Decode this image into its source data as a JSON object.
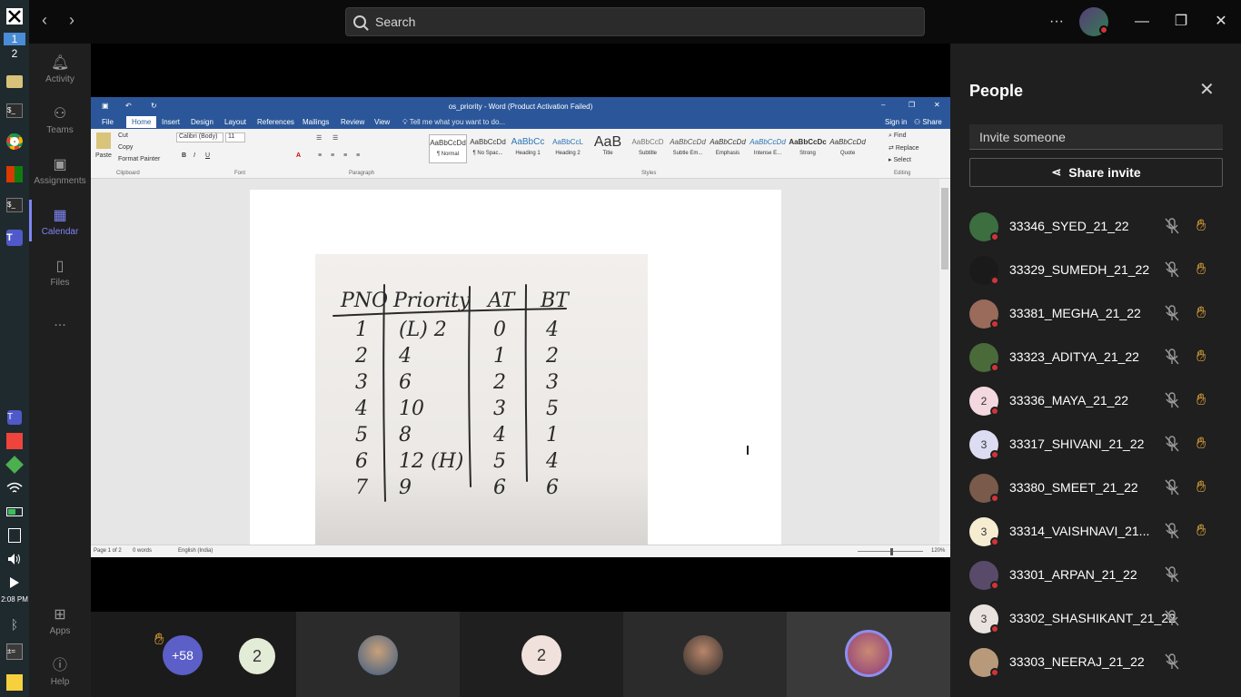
{
  "taskbar": {
    "desktop_numbers": [
      "1",
      "2"
    ],
    "clock": "2:08 PM"
  },
  "rail": {
    "items": [
      {
        "label": "Activity",
        "icon": "bell-icon"
      },
      {
        "label": "Teams",
        "icon": "teams-icon"
      },
      {
        "label": "Assignments",
        "icon": "assignments-icon"
      },
      {
        "label": "Calendar",
        "icon": "calendar-icon"
      },
      {
        "label": "Files",
        "icon": "files-icon"
      },
      {
        "label": "...",
        "icon": "more-icon"
      },
      {
        "label": "Apps",
        "icon": "apps-icon"
      },
      {
        "label": "Help",
        "icon": "help-icon"
      }
    ]
  },
  "titlebar": {
    "search_placeholder": "Search"
  },
  "word": {
    "title": "os_priority - Word (Product Activation Failed)",
    "tabs": [
      "File",
      "Home",
      "Insert",
      "Design",
      "Layout",
      "References",
      "Mailings",
      "Review",
      "View"
    ],
    "tell_me": "Tell me what you want to do...",
    "sign_in": "Sign in",
    "share": "Share",
    "clipboard": {
      "paste": "Paste",
      "cut": "Cut",
      "copy": "Copy",
      "format_painter": "Format Painter",
      "label": "Clipboard"
    },
    "font": {
      "name": "Calibri (Body)",
      "size": "11",
      "label": "Font"
    },
    "paragraph_label": "Paragraph",
    "styles_label": "Styles",
    "styles": [
      {
        "sample": "AaBbCcDd",
        "name": "¶ Normal"
      },
      {
        "sample": "AaBbCcDd",
        "name": "¶ No Spac..."
      },
      {
        "sample": "AaBbCc",
        "name": "Heading 1"
      },
      {
        "sample": "AaBbCcL",
        "name": "Heading 2"
      },
      {
        "sample": "AaB",
        "name": "Title"
      },
      {
        "sample": "AaBbCcD",
        "name": "Subtitle"
      },
      {
        "sample": "AaBbCcDd",
        "name": "Subtle Em..."
      },
      {
        "sample": "AaBbCcDd",
        "name": "Emphasis"
      },
      {
        "sample": "AaBbCcDd",
        "name": "Intense E..."
      },
      {
        "sample": "AaBbCcDc",
        "name": "Strong"
      },
      {
        "sample": "AaBbCcDd",
        "name": "Quote"
      }
    ],
    "editing": {
      "find": "Find",
      "replace": "Replace",
      "select": "Select",
      "label": "Editing"
    },
    "status": {
      "page": "Page 1 of 2",
      "words": "0 words",
      "language": "English (India)",
      "zoom": "120%"
    }
  },
  "handwritten_table": {
    "headers": [
      "PNO",
      "Priority",
      "AT",
      "BT"
    ],
    "rows": [
      [
        "1",
        "(L) 2",
        "0",
        "4"
      ],
      [
        "2",
        "4",
        "1",
        "2"
      ],
      [
        "3",
        "6",
        "2",
        "3"
      ],
      [
        "4",
        "10",
        "3",
        "5"
      ],
      [
        "5",
        "8",
        "4",
        "1"
      ],
      [
        "6",
        "12 (H)",
        "5",
        "4"
      ],
      [
        "7",
        "9",
        "6",
        "6"
      ]
    ]
  },
  "gallery": {
    "overflow_count": "+58",
    "tiles": [
      "2",
      "",
      "2",
      "",
      ""
    ]
  },
  "people": {
    "title": "People",
    "invite_placeholder": "Invite someone",
    "share_invite": "Share invite",
    "participants": [
      {
        "name": "33346_SYED_21_22",
        "avatar": "",
        "hand": true
      },
      {
        "name": "33329_SUMEDH_21_22",
        "avatar": "",
        "hand": true
      },
      {
        "name": "33381_MEGHA_21_22",
        "avatar": "",
        "hand": true
      },
      {
        "name": "33323_ADITYA_21_22",
        "avatar": "",
        "hand": true
      },
      {
        "name": "33336_MAYA_21_22",
        "avatar": "2",
        "hand": true
      },
      {
        "name": "33317_SHIVANI_21_22",
        "avatar": "3",
        "hand": true
      },
      {
        "name": "33380_SMEET_21_22",
        "avatar": "",
        "hand": true
      },
      {
        "name": "33314_VAISHNAVI_21...",
        "avatar": "3",
        "hand": true
      },
      {
        "name": "33301_ARPAN_21_22",
        "avatar": "",
        "hand": false
      },
      {
        "name": "33302_SHASHIKANT_21_22",
        "avatar": "3",
        "hand": false
      },
      {
        "name": "33303_NEERAJ_21_22",
        "avatar": "",
        "hand": false
      }
    ]
  },
  "colors": {
    "teams_accent": "#7f85f5",
    "word_blue": "#2b579a",
    "hand_raise": "#f7b43b",
    "status_dot": "#d13438"
  }
}
